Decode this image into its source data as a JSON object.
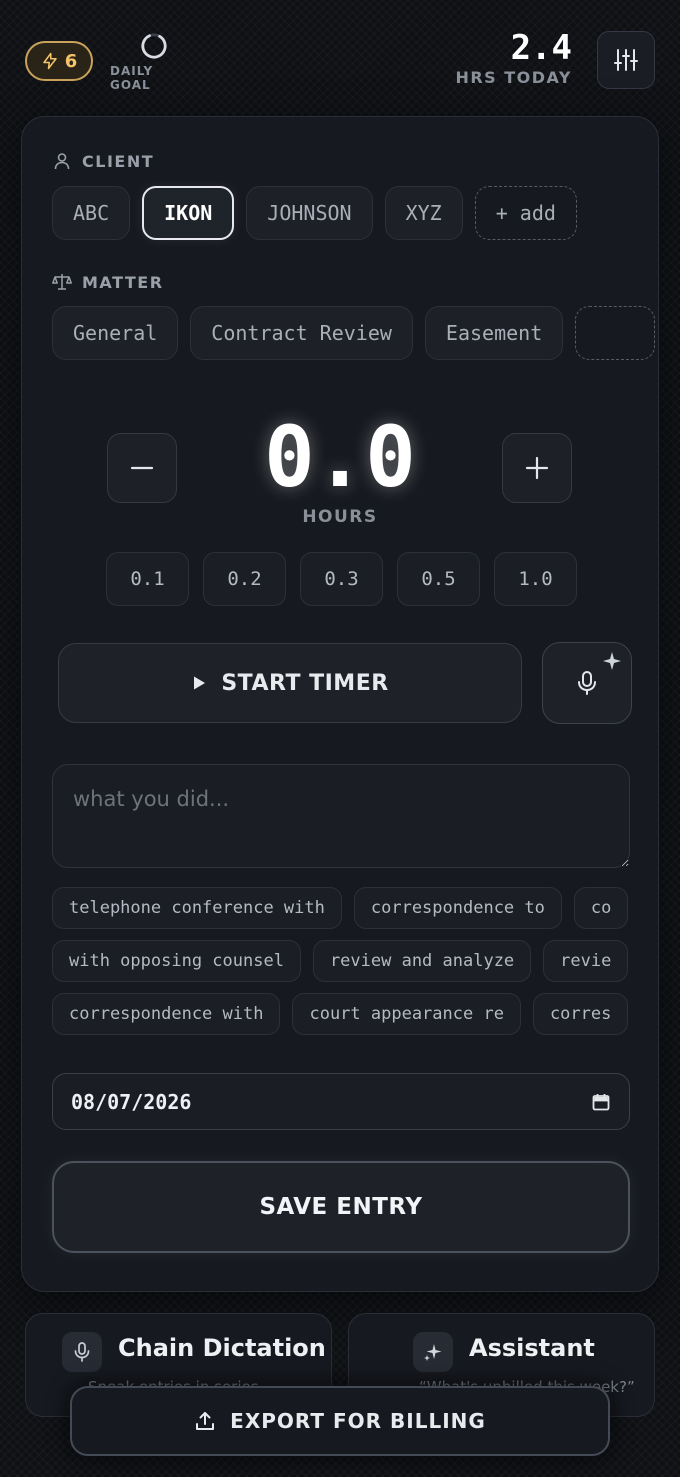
{
  "header": {
    "streak_count": "6",
    "daily_goal_label": "DAILY GOAL",
    "hours_today_value": "2.4",
    "hours_today_label": "HRS TODAY"
  },
  "client": {
    "label": "CLIENT",
    "options": [
      "ABC",
      "IKON",
      "JOHNSON",
      "XYZ"
    ],
    "selected": "IKON",
    "add_label": "+ add"
  },
  "matter": {
    "label": "MATTER",
    "options": [
      "General",
      "Contract Review",
      "Easement"
    ]
  },
  "hours": {
    "value": "0.0",
    "label": "HOURS",
    "presets": [
      "0.1",
      "0.2",
      "0.3",
      "0.5",
      "1.0"
    ]
  },
  "timer": {
    "start_label": "START TIMER"
  },
  "description": {
    "placeholder": "what you did...",
    "value": ""
  },
  "phrases": [
    [
      "telephone conference with",
      "correspondence to",
      "co"
    ],
    [
      "with opposing counsel",
      "review and analyze",
      "revie"
    ],
    [
      "correspondence with",
      "court appearance re",
      "corres"
    ]
  ],
  "date": {
    "value": "08/07/2026"
  },
  "save": {
    "label": "SAVE ENTRY"
  },
  "tools": {
    "dictation": {
      "title": "Chain Dictation",
      "subtitle": "Speak entries in series"
    },
    "assistant": {
      "title": "Assistant",
      "subtitle": "“What's unbilled this week?”"
    }
  },
  "export": {
    "label": "EXPORT FOR BILLING"
  },
  "colors": {
    "accent_gold": "#f3c46a",
    "background": "#0e1014",
    "card": "#16191f"
  }
}
